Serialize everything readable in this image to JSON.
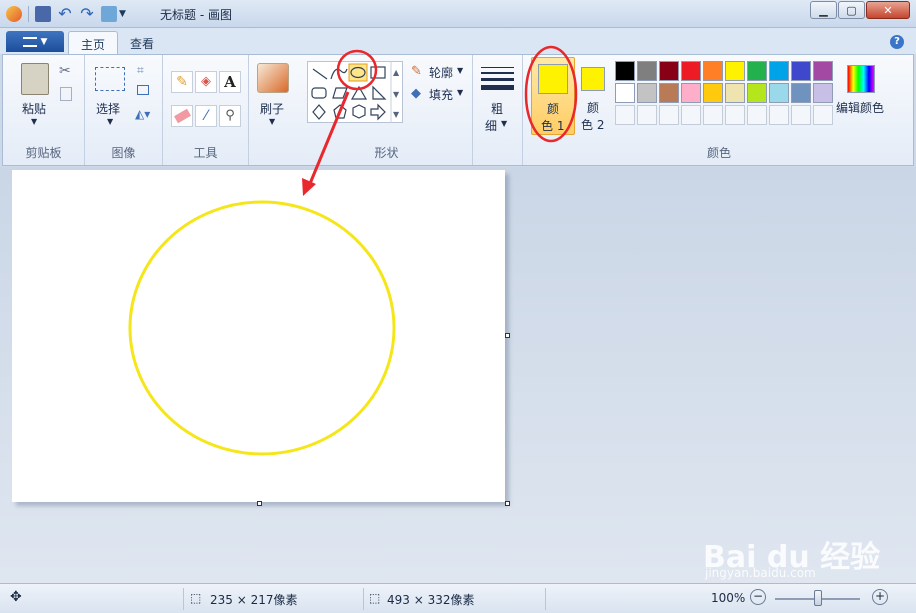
{
  "title": "无标题 - 画图",
  "window": {
    "minimize_icon": "minimize-icon",
    "maximize_icon": "maximize-icon",
    "close_icon": "close-icon"
  },
  "tabs": [
    {
      "label": "主页",
      "active": true
    },
    {
      "label": "查看",
      "active": false
    }
  ],
  "file_menu_icon": "menu-icon",
  "ribbon": {
    "clipboard": {
      "group_label": "剪贴板",
      "paste_label": "粘贴"
    },
    "image": {
      "group_label": "图像",
      "select_label": "选择"
    },
    "tools": {
      "group_label": "工具"
    },
    "brushes": {
      "label": "刷子"
    },
    "shapes": {
      "group_label": "形状",
      "outline_label": "轮廓",
      "fill_label": "填充"
    },
    "size": {
      "label_top": "粗",
      "label_bottom": "细"
    },
    "colors": {
      "group_label": "颜色",
      "color1_label_top": "颜",
      "color1_label_bottom": "色 1",
      "color2_label_top": "颜",
      "color2_label_bottom": "色 2",
      "color1_value": "#fff200",
      "color2_value": "#fff200",
      "edit_colors_label": "编辑颜色",
      "palette_row1": [
        "#000000",
        "#7f7f7f",
        "#880015",
        "#ed1c24",
        "#ff7f27",
        "#fff200",
        "#22b14c",
        "#00a2e8",
        "#3f48cc",
        "#a349a4"
      ],
      "palette_row2": [
        "#ffffff",
        "#c3c3c3",
        "#b97a57",
        "#ffaec9",
        "#ffc90e",
        "#efe4b0",
        "#b5e61d",
        "#99d9ea",
        "#7092be",
        "#c8bfe7"
      ]
    }
  },
  "canvas": {
    "shape": "ellipse",
    "stroke_color": "#f5e61a",
    "fill": "none"
  },
  "annotation_color": "#e8282c",
  "status": {
    "selection_size": "235 × 217像素",
    "canvas_size": "493 × 332像素",
    "zoom": "100%"
  },
  "watermark": {
    "logo": "Bai du 经验",
    "url": "jingyan.baidu.com"
  }
}
